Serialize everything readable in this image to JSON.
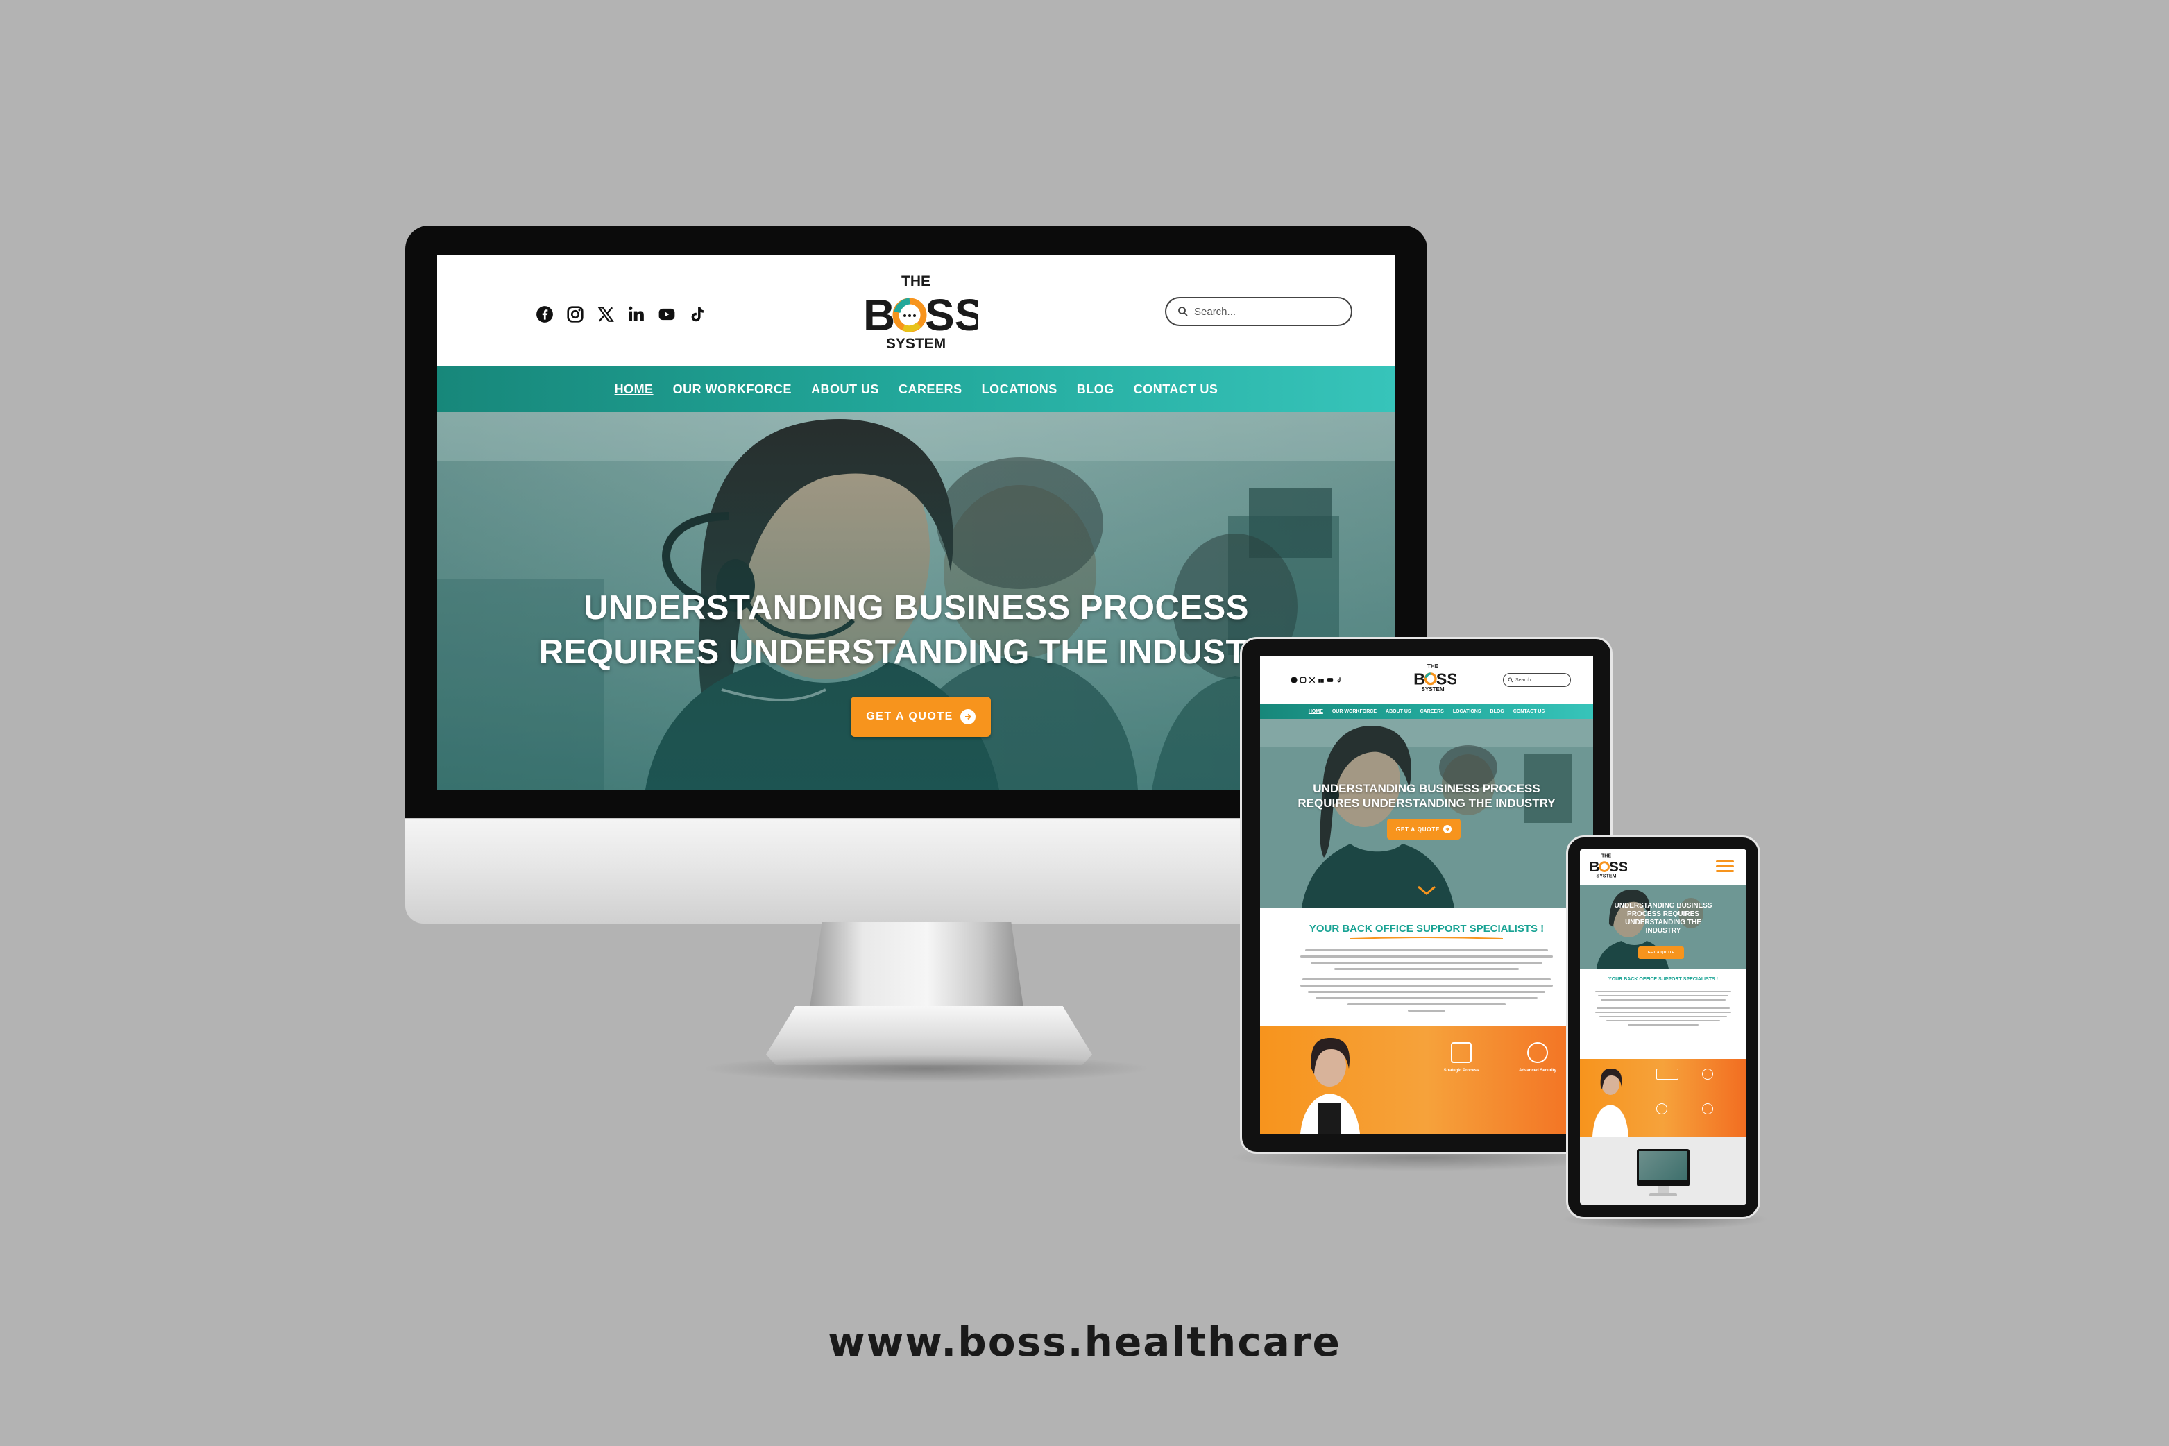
{
  "site": {
    "url_caption": "www.boss.healthcare",
    "logo": {
      "top": "THE",
      "main": "BOSS",
      "bottom": "SYSTEM"
    },
    "social_icons": [
      "facebook-icon",
      "instagram-icon",
      "x-icon",
      "linkedin-icon",
      "youtube-icon",
      "tiktok-icon"
    ],
    "search": {
      "placeholder": "Search..."
    },
    "nav": {
      "items": [
        {
          "label": "HOME",
          "active": true
        },
        {
          "label": "OUR WORKFORCE",
          "active": false
        },
        {
          "label": "ABOUT US",
          "active": false
        },
        {
          "label": "CAREERS",
          "active": false
        },
        {
          "label": "LOCATIONS",
          "active": false
        },
        {
          "label": "BLOG",
          "active": false
        },
        {
          "label": "CONTACT US",
          "active": false
        }
      ]
    },
    "hero": {
      "line1": "UNDERSTANDING BUSINESS PROCESS",
      "line2": "REQUIRES UNDERSTANDING THE INDUSTRY",
      "cta": "GET A QUOTE"
    },
    "intro": {
      "title": "YOUR BACK OFFICE SUPPORT SPECIALISTS !"
    },
    "features": [
      {
        "title": "Strategic Process",
        "icon": "document-icon"
      },
      {
        "title": "Advanced Security",
        "icon": "shield-icon"
      }
    ],
    "phone_hero": {
      "line1": "UNDERSTANDING BUSINESS",
      "line2": "PROCESS REQUIRES",
      "line3": "UNDERSTANDING THE",
      "line4": "INDUSTRY",
      "cta": "GET A QUOTE"
    }
  },
  "colors": {
    "background": "#b3b3b3",
    "teal": "#22a89b",
    "teal_dark": "#17877a",
    "orange": "#f7941d",
    "logo_dark": "#1a1a1a"
  }
}
